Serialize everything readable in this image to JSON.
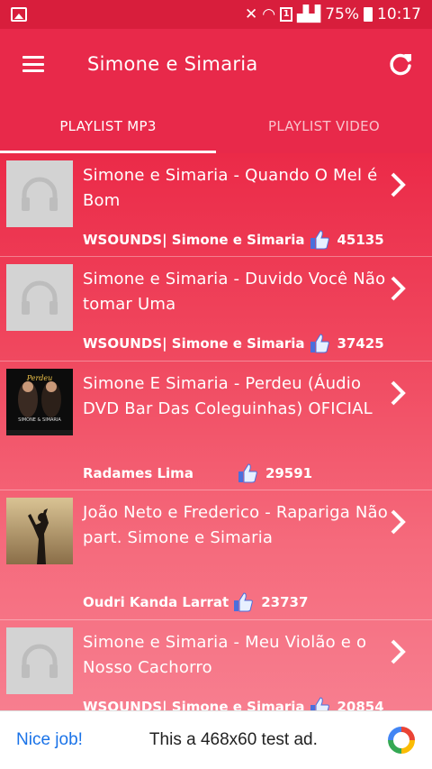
{
  "status_bar": {
    "battery": "75%",
    "time": "10:17",
    "sim_label": "1"
  },
  "app_bar": {
    "title": "Simone e Simaria"
  },
  "tabs": [
    {
      "label": "PLAYLIST MP3",
      "active": true
    },
    {
      "label": "PLAYLIST VIDEO",
      "active": false
    }
  ],
  "items": [
    {
      "title": "Simone e Simaria - Quando O Mel é Bom",
      "author": "WSOUNDS| Simone e Simaria",
      "likes": "45135",
      "thumbnail": "headphones-placeholder"
    },
    {
      "title": "Simone e Simaria - Duvido Você Não tomar Uma",
      "author": "WSOUNDS| Simone e Simaria",
      "likes": "37425",
      "thumbnail": "headphones-placeholder"
    },
    {
      "title": "Simone E Simaria - Perdeu (Áudio DVD Bar Das Coleguinhas) OFICIAL",
      "author": "Radames Lima",
      "likes": "29591",
      "thumbnail": "album-cover-perdeu",
      "thumb_text": "Perdeu",
      "thumb_subtext": "SIMONE & SIMARIA"
    },
    {
      "title": "João Neto e Frederico - Rapariga Não part. Simone e Simaria",
      "author": "Oudri Kanda Larrat",
      "likes": "23737",
      "thumbnail": "silhouette-photo"
    },
    {
      "title": "Simone e Simaria - Meu Violão e o Nosso Cachorro",
      "author": "WSOUNDS| Simone e Simaria",
      "likes": "20854",
      "thumbnail": "headphones-placeholder"
    }
  ],
  "ad": {
    "nice": "Nice job!",
    "text": "This a 468x60 test ad.",
    "logo": "adchoices-logo"
  },
  "colors": {
    "status_bar": "#d81e3c",
    "app_bar": "#e8294a",
    "list_top": "#eb2a48",
    "list_bottom": "#f77e8f",
    "ad_link": "#1a73e8"
  }
}
